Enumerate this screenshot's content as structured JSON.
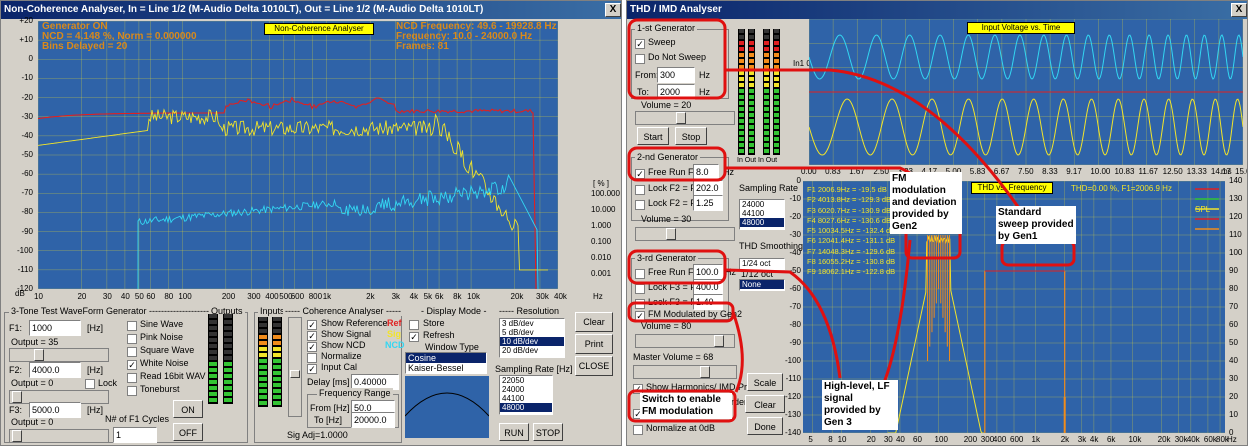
{
  "left_window": {
    "title": "Non-Coherence Analyser, In = Line 1/2 (M-Audio Delta 1010LT), Out = Line 1/2 (M-Audio Delta 1010LT)",
    "close": "X",
    "plot_label": "Non-Coherence Analyser",
    "info_left": [
      "Generator ON",
      "NCD = 4.148 %, Norm = 0.000000",
      "Bins Delayed = 20"
    ],
    "info_right": [
      "NCD Frequency: 49.6 - 19928.8 Hz",
      "Frequency: 10.0 - 24000.0 Hz",
      "Frames: 81"
    ],
    "y_ticks": [
      "+20",
      "+10",
      "0",
      "-10",
      "-20",
      "-30",
      "-40",
      "-50",
      "-60",
      "-70",
      "-80",
      "-90",
      "-100",
      "-110",
      "-120"
    ],
    "y_unit": "dB",
    "pct_unit": "[ % ]",
    "pct_ticks": [
      "100.000",
      "10.000",
      "1.000",
      "0.100",
      "0.010",
      "0.001"
    ],
    "x_ticks": [
      "10",
      "20",
      "30",
      "40",
      "50",
      "60",
      "80",
      "100",
      "200",
      "300",
      "400",
      "500",
      "600",
      "800",
      "1k",
      "2k",
      "3k",
      "4k",
      "5k",
      "6k",
      "8k",
      "10k",
      "20k",
      "30k",
      "40k"
    ],
    "x_unit": "Hz",
    "gen": {
      "title": "3-Tone Test WaveForm Generator ----------------------------",
      "f1_label": "F1:",
      "f1_value": "1000",
      "f1_unit": "[Hz]",
      "out1": "Output = 35",
      "f2_label": "F2:",
      "f2_value": "4000.0",
      "f2_unit": "[Hz]",
      "out2": "Output = 0",
      "lock": "Lock",
      "f3_label": "F3:",
      "f3_value": "5000.0",
      "f3_unit": "[Hz]",
      "out3": "Output = 0",
      "cycles_label": "N# of F1 Cycles",
      "cycles_value": "1",
      "waves": [
        "Sine Wave",
        "Pink Noise",
        "Square Wave",
        "White Noise",
        "Read 16bit WAV",
        "Toneburst"
      ],
      "outputs_label": "Outputs",
      "on": "ON",
      "off": "OFF"
    },
    "coh": {
      "inputs_label": "Inputs",
      "title": "----- Coherence Analyser -----",
      "show_reference": "Show Reference",
      "show_signal": "Show Signal",
      "show_ncd": "Show NCD",
      "normalize": "Normalize",
      "input_cal": "Input Cal",
      "ref": "Ref",
      "sig": "Sig",
      "ncd": "NCD",
      "delay_label": "Delay [ms]",
      "delay_value": "0.40000",
      "freq_range": "Frequency Range",
      "from_label": "From [Hz]",
      "from_value": "50.0",
      "to_label": "To [Hz]",
      "to_value": "20000.0",
      "sig_adj": "Sig Adj=1.0000"
    },
    "display": {
      "title": "- Display Mode -",
      "store": "Store",
      "refresh": "Refresh",
      "window_type": "Window Type",
      "windows": [
        "Cosine",
        "Kaiser-Bessel"
      ]
    },
    "resolution": {
      "title": "----- Resolution",
      "items": [
        "3 dB/dev",
        "5 dB/dev",
        "10 dB/dev",
        "20 dB/dev"
      ],
      "selected": 2,
      "sr_title": "Sampling Rate [Hz]",
      "sr_items": [
        "22050",
        "24000",
        "44100",
        "48000"
      ],
      "sr_selected": 3,
      "run": "RUN",
      "stop": "STOP"
    },
    "buttons": {
      "clear": "Clear",
      "print": "Print",
      "close": "CLOSE"
    }
  },
  "right_window": {
    "title": "THD / IMD Analyser",
    "close": "X",
    "gen1": {
      "title": "1-st Generator",
      "sweep": "Sweep",
      "do_not_sweep": "Do Not Sweep",
      "from_label": "From:",
      "from_value": "300",
      "hz": "Hz",
      "to_label": "To:",
      "to_value": "2000",
      "volume": "Volume = 20",
      "start": "Start",
      "stop": "Stop"
    },
    "gen2": {
      "title": "2-nd Generator",
      "free_run": "Free Run F2=",
      "free_value": "8.0",
      "hz": "Hz",
      "lock1": "Lock F2 = F1+",
      "lock1_value": "202.0",
      "lock2": "Lock F2 = F1*",
      "lock2_value": "1.25",
      "volume": "Volume = 30"
    },
    "gen3": {
      "title": "3-rd Generator",
      "free_run": "Free Run F3=",
      "free_value": "100.0",
      "hz": "Hz",
      "lock1": "Lock F3 = F1+",
      "lock1_value": "400.0",
      "lock2": "Lock F3 = F1*",
      "lock2_value": "1.40",
      "fm": "FM Modulated by Gen2",
      "volume": "Volume = 80"
    },
    "master": "Master Volume = 68",
    "show_harmonics": "Show Harmonics/ IMD Products",
    "normalize": "Normalize at 0dB",
    "meters_label": "In  Out  In  Out",
    "sampling_title": "Sampling Rate",
    "sampling_items": [
      "24000",
      "44100",
      "48000"
    ],
    "sampling_selected": 2,
    "smoothing_title": "THD Smoothing",
    "smoothing_value": "1/24 oct",
    "smoothing_hidden": "1/12 oct",
    "smoothing_none": "None",
    "buttons": {
      "scale": "Scale",
      "clear_plots": "Clear Plots",
      "done": "Done"
    },
    "top_plot": {
      "label": "Input Voltage vs. Time",
      "y_ticks": [
        "In1 0"
      ],
      "x_ticks": [
        "0.00",
        "0.83",
        "1.67",
        "2.50",
        "3.33",
        "4.17",
        "5.00",
        "5.83",
        "6.67",
        "7.50",
        "8.33",
        "9.17",
        "10.00",
        "10.83",
        "11.67",
        "12.50",
        "13.33",
        "14.17",
        "15.00"
      ],
      "x_unit": "ms"
    },
    "bottom_plot": {
      "label": "THD vs. Frequency",
      "thd_text": "THD=0.00 %, F1=2006.9 Hz",
      "spl": "SPL",
      "harmonics": [
        "F1 2006.9Hz = -19.5 dB",
        "F2 4013.8Hz = -129.3 dB",
        "F3 6020.7Hz = -130.9 dB",
        "F4 8027.6Hz = -130.6 dB",
        "F5 10034.5Hz = -132.4 dB",
        "F6 12041.4Hz = -131.1 dB",
        "F7 14048.3Hz = -129.6 dB",
        "F8 16055.2Hz = -130.8 dB",
        "F9 18062.1Hz = -122.8 dB"
      ],
      "y_left": [
        "0",
        "-10",
        "-20",
        "-30",
        "-40",
        "-50",
        "-60",
        "-70",
        "-80",
        "-90",
        "-100",
        "-110",
        "-120",
        "-130",
        "-140"
      ],
      "y_right": [
        "140",
        "130",
        "120",
        "110",
        "100",
        "90",
        "80",
        "70",
        "60",
        "50",
        "40",
        "30",
        "20",
        "10",
        "0"
      ],
      "x_ticks": [
        "5",
        "8",
        "10",
        "20",
        "30",
        "40",
        "60",
        "100",
        "200",
        "300",
        "400",
        "600",
        "1k",
        "2k",
        "3k",
        "4k",
        "6k",
        "10k",
        "20k",
        "30k",
        "40k",
        "60k",
        "80k"
      ],
      "x_unit": "Hz"
    }
  },
  "annotations": {
    "fm_mod": "FM modulation and deviation provided by Gen2",
    "sweep": "Standard sweep provided by Gen1",
    "lf_signal": "High-level, LF signal provided by Gen 3",
    "switch_fm": "Switch to enable FM modulation",
    "switch_hidden": "rder"
  },
  "colors": {
    "plot_bg": "#2f63a8",
    "ref_red": "#e02020",
    "sig_yellow": "#f2e42a",
    "ncd_cyan": "#33d6f2",
    "callout_red": "#e01010"
  }
}
